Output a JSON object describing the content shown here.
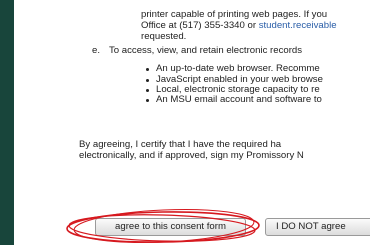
{
  "consent": {
    "para_d": {
      "line1": "printer capable of printing web pages. If you",
      "line2_pre": "Office at (517) 355-3340 or ",
      "line2_link": "student.receivable",
      "line3": "requested."
    },
    "item_e": {
      "marker": "e.",
      "text": "To access, view, and retain electronic records"
    },
    "requirements": [
      "An up-to-date web browser. Recomme",
      "JavaScript enabled in your web browse",
      "Local, electronic storage capacity to re",
      "An MSU email account and software to"
    ],
    "agreement": {
      "line1": "By agreeing, I certify that I have the required ha",
      "line2": "electronically, and if approved, sign my Promissory N"
    }
  },
  "buttons": {
    "agree_label": "agree to this consent form",
    "disagree_label": "I DO NOT agree"
  },
  "colors": {
    "frame": "#18453b",
    "link": "#2a5ea8",
    "annotation": "#d6191f"
  }
}
